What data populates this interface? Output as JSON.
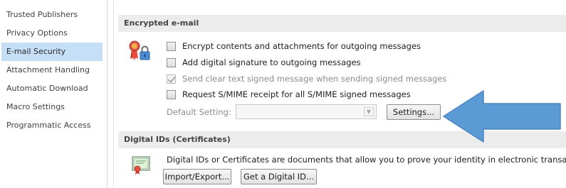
{
  "nav": {
    "items": [
      {
        "label": "Trusted Publishers"
      },
      {
        "label": "Privacy Options"
      },
      {
        "label": "E-mail Security",
        "selected": true
      },
      {
        "label": "Attachment Handling"
      },
      {
        "label": "Automatic Download"
      },
      {
        "label": "Macro Settings"
      },
      {
        "label": "Programmatic Access"
      }
    ]
  },
  "encrypted_email": {
    "header": "Encrypted e-mail",
    "options": [
      {
        "label": "Encrypt contents and attachments for outgoing messages",
        "checked": false,
        "enabled": true
      },
      {
        "label": "Add digital signature to outgoing messages",
        "checked": false,
        "enabled": true
      },
      {
        "label": "Send clear text signed message when sending signed messages",
        "checked": true,
        "enabled": false
      },
      {
        "label": "Request S/MIME receipt for all S/MIME signed messages",
        "checked": false,
        "enabled": true
      }
    ],
    "default_setting_label": "Default Setting:",
    "default_setting_value": "",
    "settings_button": "Settings..."
  },
  "digital_ids": {
    "header": "Digital IDs (Certificates)",
    "description": "Digital IDs or Certificates are documents that allow you to prove your identity in electronic transactions.",
    "import_export_button": "Import/Export...",
    "get_id_button": "Get a Digital ID..."
  },
  "colors": {
    "nav_selected": "#c5dff6",
    "section_header_bg": "#ececec",
    "callout_arrow": "#5b9bd5"
  },
  "icons": {
    "encryption": "ribbon-lock-icon",
    "certificate": "certificate-icon",
    "annotation": "callout-arrow-left"
  }
}
